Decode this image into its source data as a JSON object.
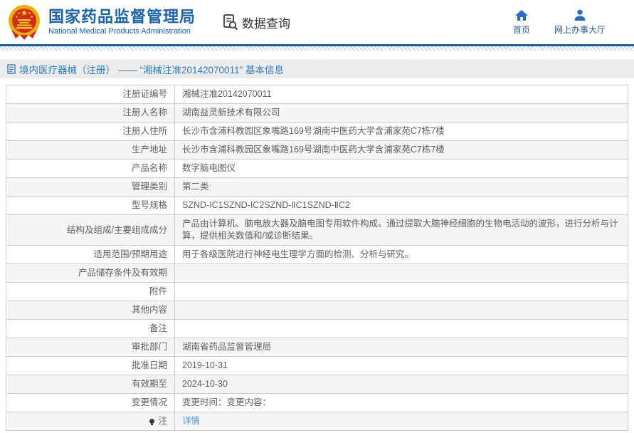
{
  "header": {
    "agency_title": "国家药品监督管理局",
    "agency_subtitle": "National Medical Products Administration",
    "section_label": "数据查询",
    "nav": [
      {
        "label": "首页",
        "icon": "home-icon"
      },
      {
        "label": "网上办事大厅",
        "icon": "user-icon"
      }
    ]
  },
  "breadcrumb": "境内医疗器械（注册） —— “湘械注准20142070011” 基本信息",
  "table": {
    "rows": [
      {
        "label": "注册证编号",
        "value": "湘械注准20142070011"
      },
      {
        "label": "注册人名称",
        "value": "湖南益灵新技术有限公司"
      },
      {
        "label": "注册人住所",
        "value": "长沙市含浦科教园区象嘴路169号湖南中医药大学含浦家苑C7栋7楼"
      },
      {
        "label": "生产地址",
        "value": "长沙市含浦科教园区象嘴路169号湖南中医药大学含浦家苑C7栋7楼"
      },
      {
        "label": "产品名称",
        "value": "数字脑电图仪"
      },
      {
        "label": "管理类别",
        "value": "第二类"
      },
      {
        "label": "型号规格",
        "value": "SZND-IC1SZND-IC2SZND-ⅡC1SZND-ⅡC2"
      },
      {
        "label": "结构及组成/主要组成成分",
        "value": "产品由计算机、脑电放大器及脑电图专用软件构成。通过提取大脑神经细胞的生物电活动的波形，进行分析与计算，提供相关数值和/或诊断结果。"
      },
      {
        "label": "适用范围/预期用途",
        "value": "用于各级医院进行神经电生理学方面的检测、分析与研究。"
      },
      {
        "label": "产品储存条件及有效期",
        "value": ""
      },
      {
        "label": "附件",
        "value": ""
      },
      {
        "label": "其他内容",
        "value": ""
      },
      {
        "label": "备注",
        "value": ""
      },
      {
        "label": "审批部门",
        "value": "湖南省药品监督管理局"
      },
      {
        "label": "批准日期",
        "value": "2019-10-31"
      },
      {
        "label": "有效期至",
        "value": "2024-10-30"
      },
      {
        "label": "变更情况",
        "value": "变更时间：变更内容："
      },
      {
        "label": "注",
        "label_icon": "bulb-icon",
        "value": "详情",
        "link": true
      }
    ]
  },
  "colors": {
    "brand_blue": "#1c63ad",
    "band_blue": "#1c5fa8",
    "breadcrumb_bg": "#ececec",
    "breadcrumb_text": "#2f7bc0",
    "link_blue": "#4a90e2",
    "emblem_red": "#d42b1d",
    "emblem_gold": "#e8b004",
    "row_alt_bg": "#f5f5f5",
    "table_border": "#cccccc",
    "body_text": "#606060"
  }
}
